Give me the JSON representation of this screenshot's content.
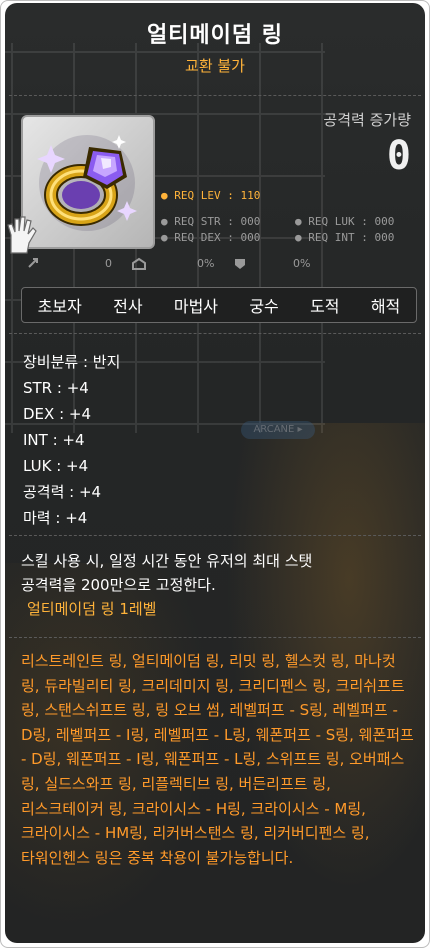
{
  "item": {
    "name": "얼티메이덤 링",
    "trade": "교환 불가",
    "attack_increase_label": "공격력 증가량",
    "attack_increase_value": "0",
    "icon": "purple-gem-gold-ring-icon"
  },
  "requirements": {
    "lev": "● REQ LEV : 110",
    "str": "● REQ STR : 000",
    "luk": "● REQ LUK : 000",
    "dex": "● REQ DEX : 000",
    "int": "● REQ INT : 000"
  },
  "stat_icons": {
    "first_value": "0",
    "second_value": "0%",
    "third_value": "0%"
  },
  "jobs": [
    "초보자",
    "전사",
    "마법사",
    "궁수",
    "도적",
    "해적"
  ],
  "stats": [
    "장비분류 : 반지",
    "STR : +4",
    "DEX : +4",
    "INT : +4",
    "LUK : +4",
    "공격력 : +4",
    "마력 : +4"
  ],
  "description": {
    "line1": "스킬 사용 시, 일정 시간 동안 유저의 최대 스탯",
    "line2": "공격력을 200만으로 고정한다.",
    "sub": "얼티메이덤 링 1레벨"
  },
  "warning": "리스트레인트 링, 얼티메이덤 링, 리밋 링, 헬스컷 링, 마나컷 링, 듀라빌리티 링, 크리데미지 링, 크리디펜스 링, 크리쉬프트 링, 스탠스쉬프트 링, 링 오브 썸, 레벨퍼프 - S링, 레벨퍼프 - D링, 레벨퍼프 - I링, 레벨퍼프 - L링, 웨폰퍼프 - S링, 웨폰퍼프 - D링, 웨폰퍼프 - I링, 웨폰퍼프 - L링, 스위프트 링, 오버패스 링, 실드스와프 링, 리플렉티브 링, 버든리프트 링, 리스크테이커 링, 크라이시스 - H링, 크라이시스 - M링, 크라이시스 - HM링, 리커버스탠스 링, 리커버디펜스 링, 타워인헨스 링은 중복 착용이 불가능합니다.",
  "background": {
    "arcane_button": "ARCANE ▸"
  },
  "colors": {
    "panel": "#262828",
    "accent_orange": "#ffb33a",
    "warning_orange": "#ff9a2a",
    "text_white": "#ffffff",
    "text_gray": "#9a9a9a"
  }
}
